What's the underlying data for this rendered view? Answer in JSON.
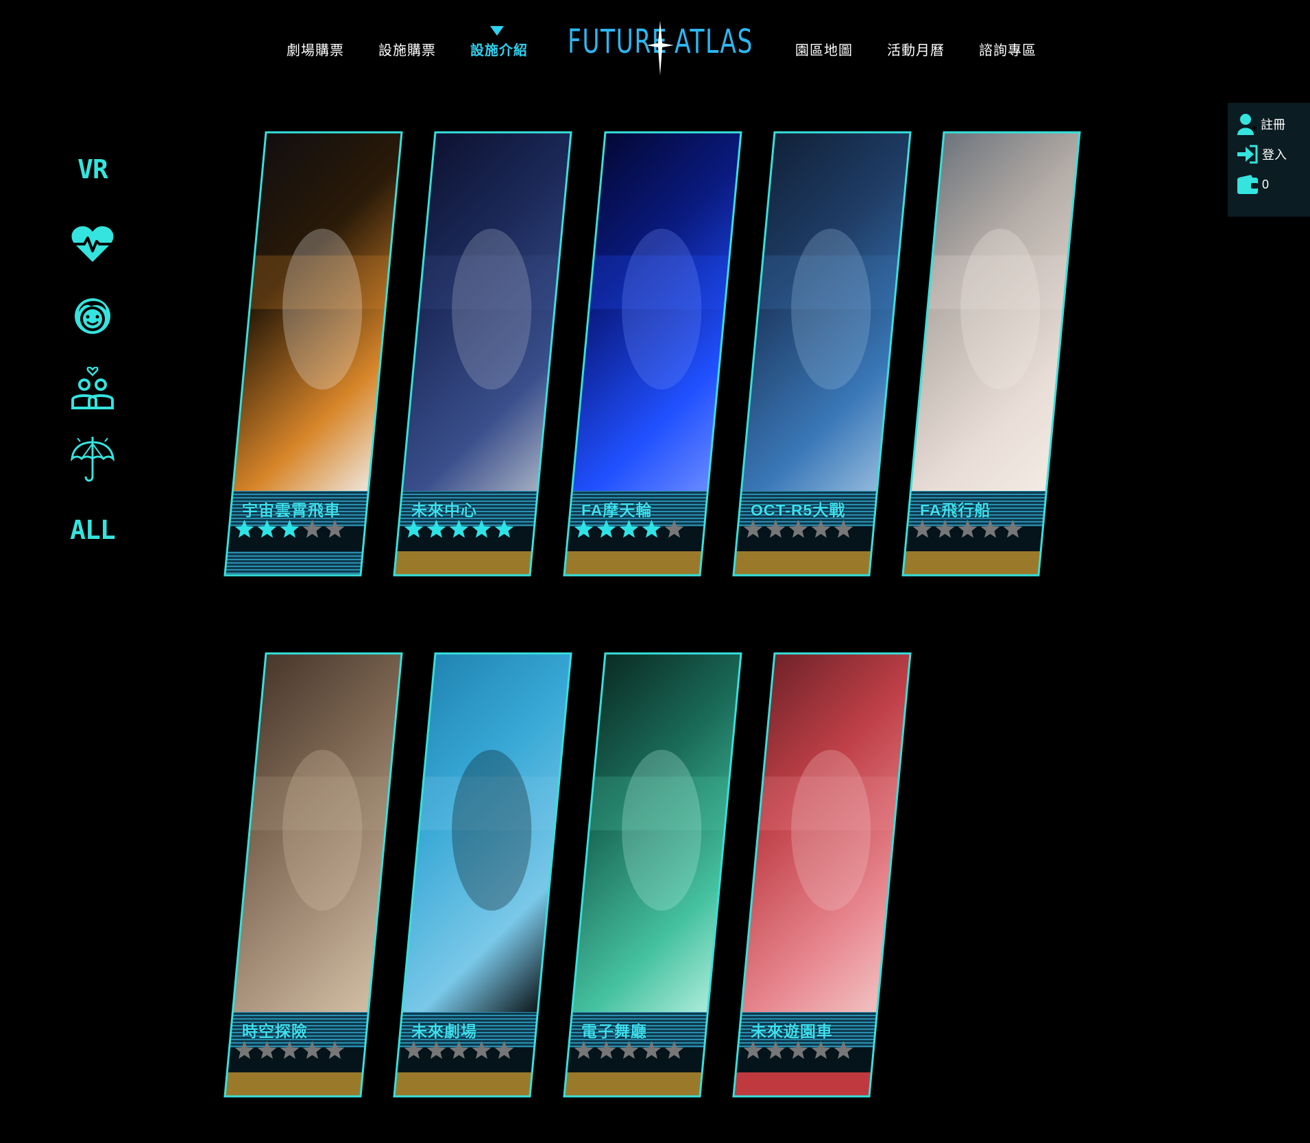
{
  "nav": {
    "items": [
      {
        "label": "劇場購票",
        "active": false
      },
      {
        "label": "設施購票",
        "active": false
      },
      {
        "label": "設施介紹",
        "active": true
      },
      {
        "label": "園區地圖",
        "active": false
      },
      {
        "label": "活動月曆",
        "active": false
      },
      {
        "label": "諮詢專區",
        "active": false
      }
    ],
    "logo_left": "FUTURE",
    "logo_right": "ATLAS"
  },
  "categories": [
    {
      "icon": "vr-icon",
      "label": "VR"
    },
    {
      "icon": "heartbeat-icon",
      "label": ""
    },
    {
      "icon": "child-face-icon",
      "label": ""
    },
    {
      "icon": "couple-icon",
      "label": ""
    },
    {
      "icon": "umbrella-icon",
      "label": ""
    },
    {
      "icon": "all-icon",
      "label": "ALL"
    }
  ],
  "user": {
    "register": "註冊",
    "login": "登入",
    "cart_count": "0"
  },
  "colors": {
    "accent": "#2fd2f0",
    "frame": "#36e0dc",
    "star_on": "#2ee3e6",
    "star_off": "#777777",
    "bar_gold": "#9a7a2a",
    "bar_red": "#c0393f"
  },
  "facilities": [
    {
      "name": "宇宙雲霄飛車",
      "rating": 3,
      "bar": "striped"
    },
    {
      "name": "未來中心",
      "rating": 5,
      "bar": "gold"
    },
    {
      "name": "FA摩天輪",
      "rating": 4,
      "bar": "gold"
    },
    {
      "name": "OCT-R5大戰",
      "rating": 0,
      "bar": "gold"
    },
    {
      "name": "FA飛行船",
      "rating": 0,
      "bar": "gold"
    },
    {
      "name": "時空探險",
      "rating": 0,
      "bar": "gold"
    },
    {
      "name": "未來劇場",
      "rating": 0,
      "bar": "gold"
    },
    {
      "name": "電子舞廳",
      "rating": 0,
      "bar": "gold"
    },
    {
      "name": "未來遊園車",
      "rating": 0,
      "bar": "red"
    }
  ]
}
